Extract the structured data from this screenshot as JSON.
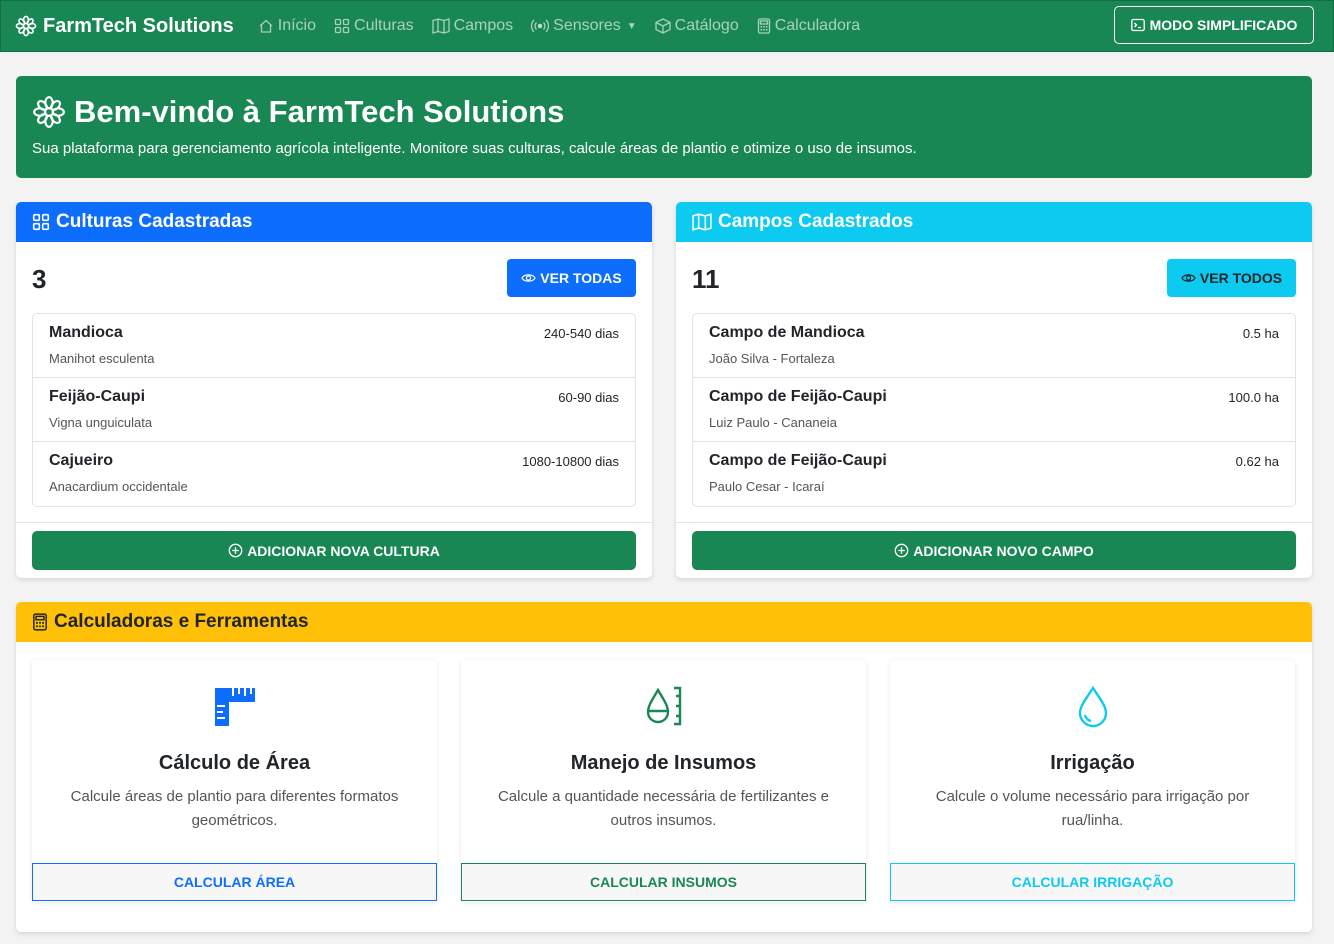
{
  "navbar": {
    "brand": "FarmTech Solutions",
    "links": [
      {
        "label": "Início",
        "icon": "house-icon"
      },
      {
        "label": "Culturas",
        "icon": "grid-icon"
      },
      {
        "label": "Campos",
        "icon": "map-icon"
      },
      {
        "label": "Sensores",
        "icon": "broadcast-icon",
        "dropdown": true
      },
      {
        "label": "Catálogo",
        "icon": "box-icon"
      },
      {
        "label": "Calculadora",
        "icon": "calculator-icon"
      }
    ],
    "simplified_button": "MODO SIMPLIFICADO"
  },
  "hero": {
    "title": "Bem-vindo à FarmTech Solutions",
    "subtitle": "Sua plataforma para gerenciamento agrícola inteligente. Monitore suas culturas, calcule áreas de plantio e otimize o uso de insumos."
  },
  "cultures": {
    "header": "Culturas Cadastradas",
    "count": "3",
    "view_button": "VER TODAS",
    "items": [
      {
        "name": "Mandioca",
        "scientific": "Manihot esculenta",
        "cycle": "240-540 dias"
      },
      {
        "name": "Feijão-Caupi",
        "scientific": "Vigna unguiculata",
        "cycle": "60-90 dias"
      },
      {
        "name": "Cajueiro",
        "scientific": "Anacardium occidentale",
        "cycle": "1080-10800 dias"
      }
    ],
    "add_button": "ADICIONAR NOVA CULTURA"
  },
  "fields": {
    "header": "Campos Cadastrados",
    "count": "11",
    "view_button": "VER TODOS",
    "items": [
      {
        "name": "Campo de Mandioca",
        "owner": "João Silva - Fortaleza",
        "area": "0.5 ha"
      },
      {
        "name": "Campo de Feijão-Caupi",
        "owner": "Luiz Paulo - Cananeia",
        "area": "100.0 ha"
      },
      {
        "name": "Campo de Feijão-Caupi",
        "owner": "Paulo Cesar - Icaraí",
        "area": "0.62 ha"
      }
    ],
    "add_button": "ADICIONAR NOVO CAMPO"
  },
  "tools": {
    "header": "Calculadoras e Ferramentas",
    "items": [
      {
        "title": "Cálculo de Área",
        "description": "Calcule áreas de plantio para diferentes formatos geométricos.",
        "button": "CALCULAR ÁREA",
        "icon": "ruler-icon",
        "color": "#0d6efd"
      },
      {
        "title": "Manejo de Insumos",
        "description": "Calcule a quantidade necessária de fertilizantes e outros insumos.",
        "button": "CALCULAR INSUMOS",
        "icon": "droplet-measure-icon",
        "color": "#198754"
      },
      {
        "title": "Irrigação",
        "description": "Calcule o volume necessário para irrigação por rua/linha.",
        "button": "CALCULAR IRRIGAÇÃO",
        "icon": "droplet-icon",
        "color": "#0dcaf0"
      }
    ]
  },
  "colors": {
    "primary": "#0d6efd",
    "success": "#198754",
    "info": "#0dcaf0",
    "warning": "#ffc107"
  }
}
